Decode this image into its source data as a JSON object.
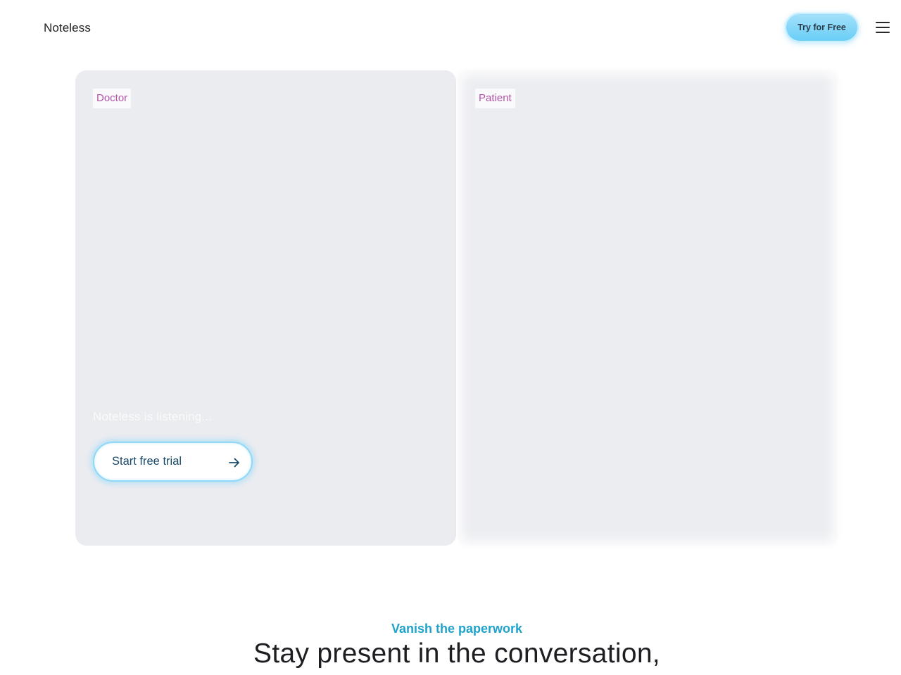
{
  "header": {
    "logo": "Noteless",
    "cta_label": "Try for Free",
    "menu_icon": "hamburger-menu-icon"
  },
  "panels": {
    "doctor": {
      "tag": "Doctor",
      "status_text": "Noteless is listening...",
      "cta_label": "Start free trial",
      "cta_icon": "arrow-right-icon"
    },
    "patient": {
      "tag": "Patient"
    }
  },
  "section": {
    "kicker": "Vanish the paperwork",
    "headline": "Stay present in the conversation,"
  },
  "colors": {
    "accent": "#1ea3cc",
    "tag_text": "#b255a8",
    "cta_gradient_top": "#a6e2fb",
    "cta_gradient_bottom": "#67cdf6",
    "panel_bg": "#ebecf0"
  }
}
